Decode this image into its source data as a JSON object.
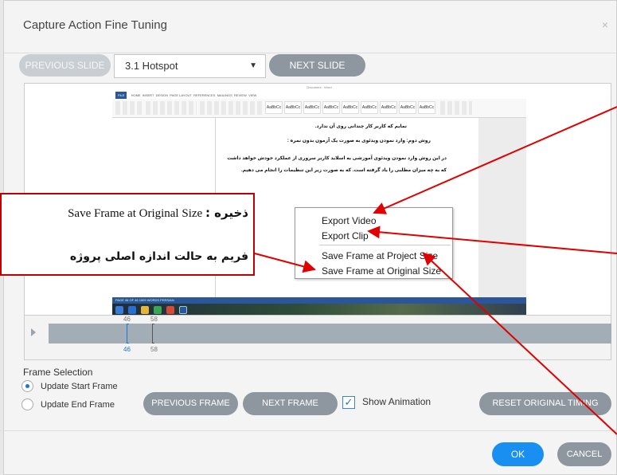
{
  "dialog": {
    "title": "Capture Action Fine Tuning",
    "close_glyph": "×"
  },
  "slide_nav": {
    "previous_label": "PREVIOUS SLIDE",
    "selected_slide": "3.1 Hotspot",
    "next_label": "NEXT SLIDE"
  },
  "word_preview": {
    "title_text": "Document - Word",
    "tabs": [
      "FILE",
      "HOME",
      "INSERT",
      "DESIGN",
      "PAGE LAYOUT",
      "REFERENCES",
      "MAILINGS",
      "REVIEW",
      "VIEW"
    ],
    "styles": [
      "AaBbCc",
      "AaBbCc",
      "AaBbCc",
      "AaBbCc",
      "AaBbCc",
      "AaBbCc",
      "AaBbCc",
      "AaBbCc",
      "AaBbCc"
    ],
    "page_lines": [
      "نمایم که کاربر کار چندانی روی آن ندارد.",
      "روش دوم: وارد نمودن ویدئوی به صورت یک آزمون بدون نمره :",
      "در این روش وارد نمودن ویدئوی آموزشی به اسلاید کاربر سروری از عملکرد خودش خواهد داشت",
      "که به چه میزان مطلبی را یاد گرفته است. که به صورت زیر این تنظیمات را انجام می دهیم."
    ],
    "status_text": "PAGE 46 OF 46    1909 WORDS    PERSIAN"
  },
  "context_menu": {
    "items": [
      "Export Video",
      "Export Clip",
      "Save Frame at Project Size",
      "Save Frame at Original Size"
    ]
  },
  "timeline": {
    "start_top": "46",
    "end_top": "58",
    "start_bottom": "46",
    "end_bottom": "58"
  },
  "frame_selection": {
    "label": "Frame Selection",
    "options": [
      "Update Start Frame",
      "Update End Frame"
    ],
    "selected": "Update Start Frame"
  },
  "frame_buttons": {
    "previous": "PREVIOUS FRAME",
    "next": "NEXT FRAME",
    "show_animation": "Show Animation",
    "show_animation_checked": true,
    "reset": "RESET ORIGINAL TIMING"
  },
  "footer": {
    "ok": "OK",
    "cancel": "CANCEL"
  },
  "annotation": {
    "line1_en": "Save Frame at Original Size",
    "line1_fa": ": ذخیره",
    "line2_fa": "فریم به حالت اندازه اصلی پروژه"
  },
  "colors": {
    "accent_blue": "#1a8ff2",
    "button_gray": "#8e979f",
    "annotation_red": "#c00000",
    "word_blue": "#2b579a"
  }
}
